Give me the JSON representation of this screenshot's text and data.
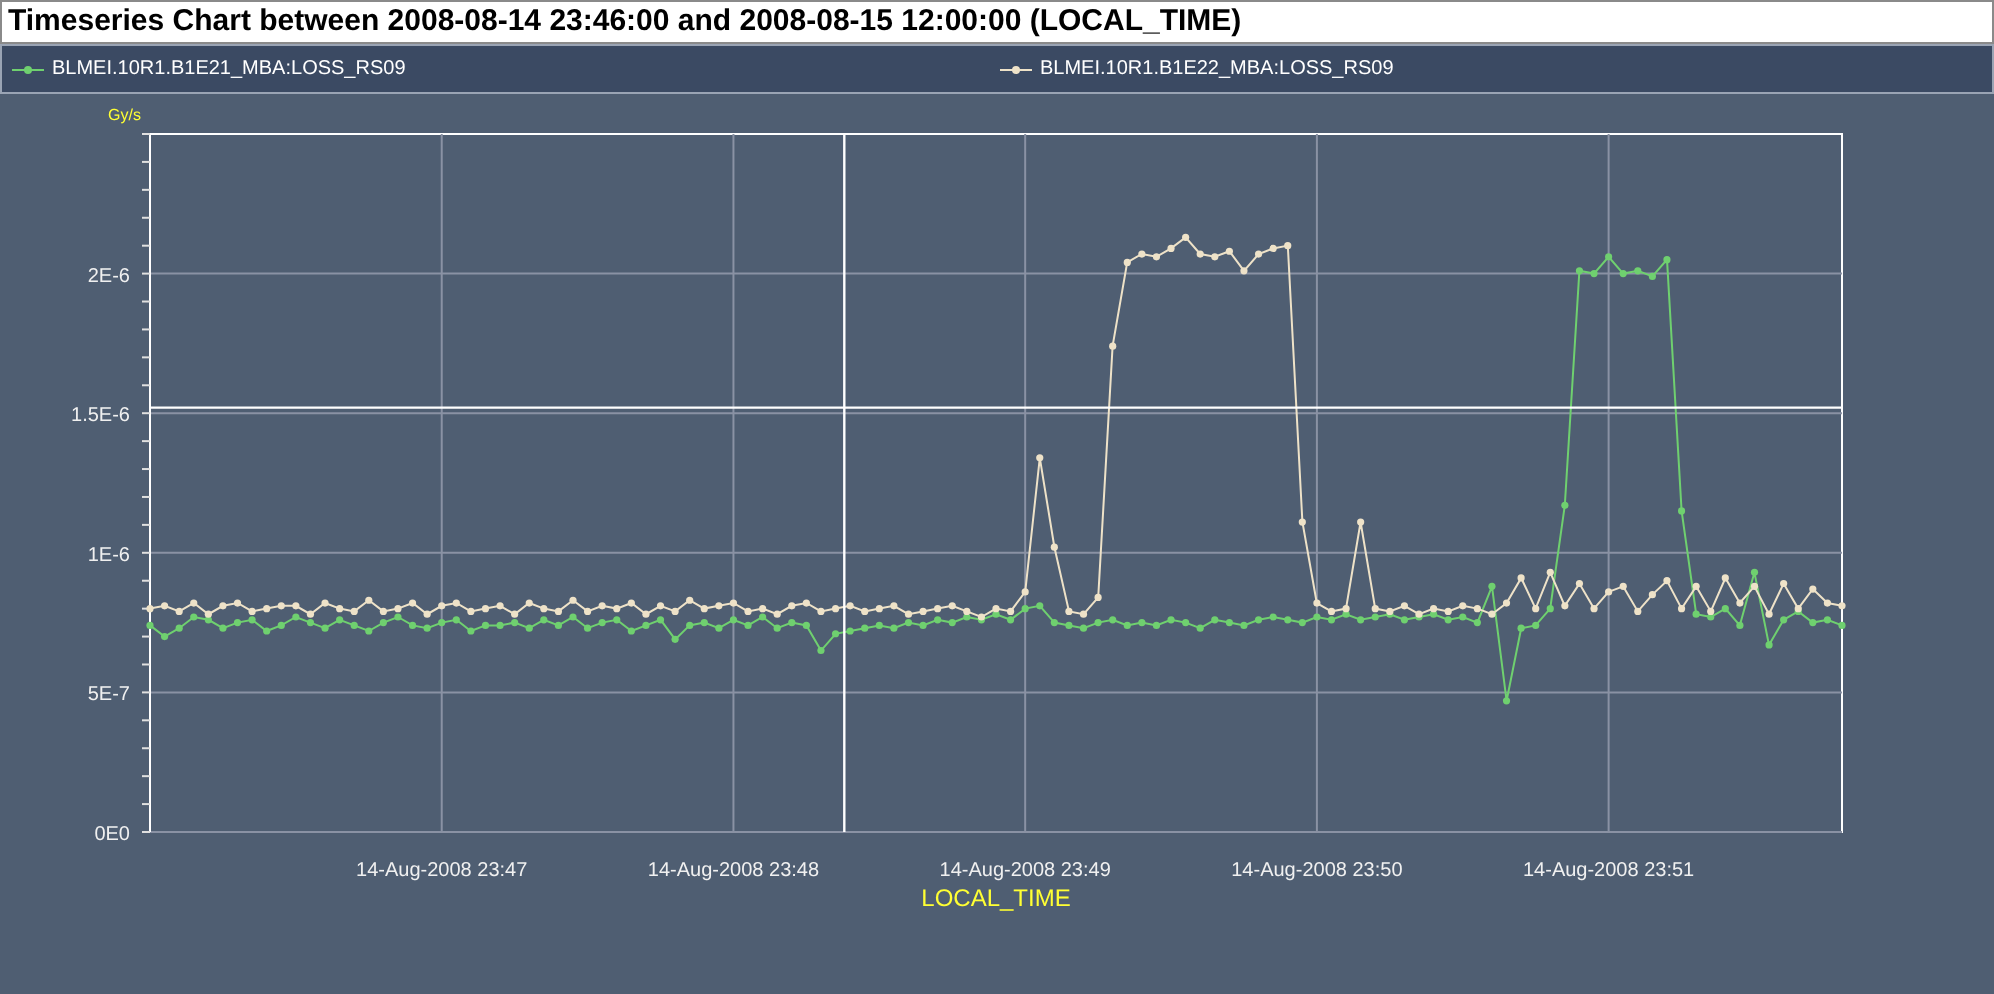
{
  "title": "Timeseries Chart between 2008-08-14 23:46:00 and 2008-08-15 12:00:00 (LOCAL_TIME)",
  "chart_data": {
    "type": "line",
    "xlabel": "LOCAL_TIME",
    "ylabel": "Gy/s",
    "categories": [
      null,
      null,
      null,
      null,
      null,
      null,
      null,
      null,
      null,
      null,
      null,
      null,
      null,
      null,
      null,
      null,
      null,
      null,
      null,
      null,
      "14-Aug-2008 23:47",
      null,
      null,
      null,
      null,
      null,
      null,
      null,
      null,
      null,
      null,
      null,
      null,
      null,
      null,
      null,
      null,
      null,
      null,
      null,
      "14-Aug-2008 23:48",
      null,
      null,
      null,
      null,
      null,
      null,
      null,
      null,
      null,
      null,
      null,
      null,
      null,
      null,
      null,
      null,
      null,
      null,
      null,
      "14-Aug-2008 23:49",
      null,
      null,
      null,
      null,
      null,
      null,
      null,
      null,
      null,
      null,
      null,
      null,
      null,
      null,
      null,
      null,
      null,
      null,
      null,
      "14-Aug-2008 23:50",
      null,
      null,
      null,
      null,
      null,
      null,
      null,
      null,
      null,
      null,
      null,
      null,
      null,
      null,
      null,
      null,
      null,
      null,
      null,
      "14-Aug-2008 23:51",
      null,
      null,
      null,
      null,
      null,
      null,
      null,
      null,
      null,
      null,
      null,
      null,
      null,
      null,
      null,
      null
    ],
    "series": [
      {
        "name": "BLMEI.10R1.B1E21_MBA:LOSS_RS09",
        "color": "#6fd06f",
        "marker": "circle",
        "values": [
          7.4e-07,
          7e-07,
          7.3e-07,
          7.7e-07,
          7.6e-07,
          7.3e-07,
          7.5e-07,
          7.6e-07,
          7.2e-07,
          7.4e-07,
          7.7e-07,
          7.5e-07,
          7.3e-07,
          7.6e-07,
          7.4e-07,
          7.2e-07,
          7.5e-07,
          7.7e-07,
          7.4e-07,
          7.3e-07,
          7.5e-07,
          7.6e-07,
          7.2e-07,
          7.4e-07,
          7.4e-07,
          7.5e-07,
          7.3e-07,
          7.6e-07,
          7.4e-07,
          7.7e-07,
          7.3e-07,
          7.5e-07,
          7.6e-07,
          7.2e-07,
          7.4e-07,
          7.6e-07,
          6.9e-07,
          7.4e-07,
          7.5e-07,
          7.3e-07,
          7.6e-07,
          7.4e-07,
          7.7e-07,
          7.3e-07,
          7.5e-07,
          7.4e-07,
          6.5e-07,
          7.1e-07,
          7.2e-07,
          7.3e-07,
          7.4e-07,
          7.3e-07,
          7.5e-07,
          7.4e-07,
          7.6e-07,
          7.5e-07,
          7.7e-07,
          7.6e-07,
          7.8e-07,
          7.6e-07,
          8e-07,
          8.1e-07,
          7.5e-07,
          7.4e-07,
          7.3e-07,
          7.5e-07,
          7.6e-07,
          7.4e-07,
          7.5e-07,
          7.4e-07,
          7.6e-07,
          7.5e-07,
          7.3e-07,
          7.6e-07,
          7.5e-07,
          7.4e-07,
          7.6e-07,
          7.7e-07,
          7.6e-07,
          7.5e-07,
          7.7e-07,
          7.6e-07,
          7.8e-07,
          7.6e-07,
          7.7e-07,
          7.8e-07,
          7.6e-07,
          7.7e-07,
          7.8e-07,
          7.6e-07,
          7.7e-07,
          7.5e-07,
          8.8e-07,
          4.7e-07,
          7.3e-07,
          7.4e-07,
          8e-07,
          1.17e-06,
          2.01e-06,
          2e-06,
          2.06e-06,
          2e-06,
          2.01e-06,
          1.99e-06,
          2.05e-06,
          1.15e-06,
          7.8e-07,
          7.7e-07,
          8e-07,
          7.4e-07,
          9.3e-07,
          6.7e-07,
          7.6e-07,
          7.9e-07,
          7.5e-07,
          7.6e-07,
          7.4e-07
        ]
      },
      {
        "name": "BLMEI.10R1.B1E22_MBA:LOSS_RS09",
        "color": "#eee2c8",
        "marker": "circle",
        "values": [
          8e-07,
          8.1e-07,
          7.9e-07,
          8.2e-07,
          7.8e-07,
          8.1e-07,
          8.2e-07,
          7.9e-07,
          8e-07,
          8.1e-07,
          8.1e-07,
          7.8e-07,
          8.2e-07,
          8e-07,
          7.9e-07,
          8.3e-07,
          7.9e-07,
          8e-07,
          8.2e-07,
          7.8e-07,
          8.1e-07,
          8.2e-07,
          7.9e-07,
          8e-07,
          8.1e-07,
          7.8e-07,
          8.2e-07,
          8e-07,
          7.9e-07,
          8.3e-07,
          7.9e-07,
          8.1e-07,
          8e-07,
          8.2e-07,
          7.8e-07,
          8.1e-07,
          7.9e-07,
          8.3e-07,
          8e-07,
          8.1e-07,
          8.2e-07,
          7.9e-07,
          8e-07,
          7.8e-07,
          8.1e-07,
          8.2e-07,
          7.9e-07,
          8e-07,
          8.1e-07,
          7.9e-07,
          8e-07,
          8.1e-07,
          7.8e-07,
          7.9e-07,
          8e-07,
          8.1e-07,
          7.9e-07,
          7.7e-07,
          8e-07,
          7.9e-07,
          8.6e-07,
          1.34e-06,
          1.02e-06,
          7.9e-07,
          7.8e-07,
          8.4e-07,
          1.74e-06,
          2.04e-06,
          2.07e-06,
          2.06e-06,
          2.09e-06,
          2.13e-06,
          2.07e-06,
          2.06e-06,
          2.08e-06,
          2.01e-06,
          2.07e-06,
          2.09e-06,
          2.1e-06,
          1.11e-06,
          8.2e-07,
          7.9e-07,
          8e-07,
          1.11e-06,
          8e-07,
          7.9e-07,
          8.1e-07,
          7.8e-07,
          8e-07,
          7.9e-07,
          8.1e-07,
          8e-07,
          7.8e-07,
          8.2e-07,
          9.1e-07,
          8e-07,
          9.3e-07,
          8.1e-07,
          8.9e-07,
          8e-07,
          8.6e-07,
          8.8e-07,
          7.9e-07,
          8.5e-07,
          9e-07,
          8e-07,
          8.8e-07,
          7.9e-07,
          9.1e-07,
          8.2e-07,
          8.8e-07,
          7.8e-07,
          8.9e-07,
          8e-07,
          8.7e-07,
          8.2e-07,
          8.1e-07
        ]
      }
    ],
    "ylim": [
      0,
      2.5e-06
    ],
    "yticks": [
      {
        "value": 0,
        "label": "0E0"
      },
      {
        "value": 5e-07,
        "label": "5E-7"
      },
      {
        "value": 1e-06,
        "label": "1E-6"
      },
      {
        "value": 1.5e-06,
        "label": "1.5E-6"
      },
      {
        "value": 2e-06,
        "label": "2E-6"
      }
    ],
    "grid": true,
    "ref_lines": [
      {
        "axis": "y",
        "value": 1.52e-06
      }
    ]
  }
}
